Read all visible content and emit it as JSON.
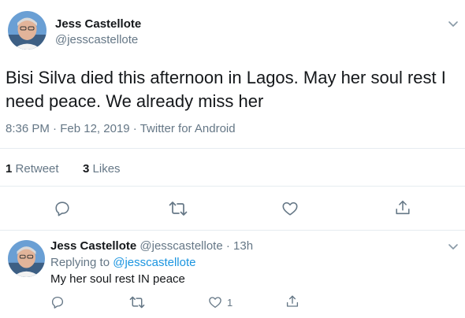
{
  "main_tweet": {
    "display_name": "Jess Castellote",
    "handle": "@jesscastellote",
    "text": "Bisi Silva died this afternoon in Lagos. May her soul rest I need peace. We already miss her",
    "time": "8:36 PM",
    "sep": "·",
    "date": "Feb 12, 2019",
    "source": "Twitter for Android",
    "retweets_count": "1",
    "retweets_label": "Retweet",
    "likes_count": "3",
    "likes_label": "Likes",
    "icons": [
      "reply-icon",
      "retweet-icon",
      "like-icon",
      "share-icon",
      "chevron-down-icon"
    ]
  },
  "reply_tweet": {
    "display_name": "Jess Castellote",
    "handle": "@jesscastellote",
    "sep": "·",
    "age": "13h",
    "replying_prefix": "Replying to",
    "replying_handle": "@jesscastellote",
    "text": "My her soul rest IN peace",
    "like_count": "1",
    "icons": [
      "reply-icon",
      "retweet-icon",
      "like-icon",
      "share-icon",
      "chevron-down-icon"
    ]
  },
  "colors": {
    "text": "#14171a",
    "muted": "#657786",
    "link": "#1b95e0",
    "divider": "#e6ecf0"
  }
}
